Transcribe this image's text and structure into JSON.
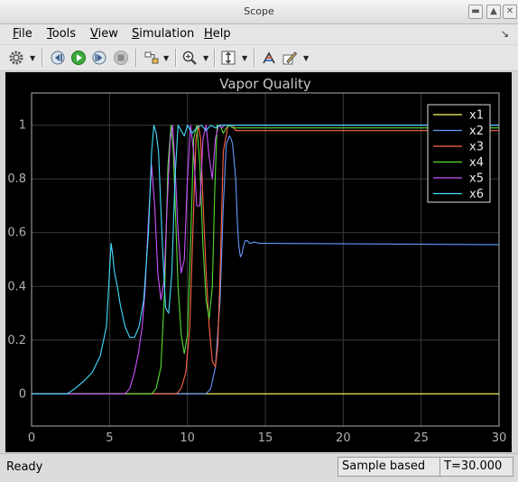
{
  "window": {
    "title": "Scope"
  },
  "menu": {
    "items": [
      {
        "accel": "F",
        "rest": "ile"
      },
      {
        "accel": "T",
        "rest": "ools"
      },
      {
        "accel": "V",
        "rest": "iew"
      },
      {
        "accel": "S",
        "rest": "imulation"
      },
      {
        "accel": "H",
        "rest": "elp"
      }
    ]
  },
  "toolbar": {
    "icons": [
      "gear-icon",
      "step-back-icon",
      "run-icon",
      "step-forward-icon",
      "stop-icon",
      "highlight-block-icon",
      "zoom-icon",
      "autoscale-icon",
      "legend-icon",
      "style-icon"
    ]
  },
  "chart_data": {
    "type": "line",
    "title": "Vapor Quality",
    "xlim": [
      0,
      30
    ],
    "ylim": [
      -0.12,
      1.12
    ],
    "xticks": [
      0,
      5,
      10,
      15,
      20,
      25,
      30
    ],
    "yticks": [
      0,
      0.2,
      0.4,
      0.6,
      0.8,
      1
    ],
    "ytick_labels": [
      "0",
      "0.2",
      "0.4",
      "0.6",
      "0.8",
      "1"
    ],
    "grid": true,
    "legend_position": "top-right",
    "colors": {
      "background": "#000000",
      "axes": "#b0b0b0",
      "title": "#c8c8c8"
    },
    "series": [
      {
        "name": "x1",
        "color": "#ffff66",
        "x": [
          0,
          30
        ],
        "y": [
          0,
          0
        ]
      },
      {
        "name": "x2",
        "color": "#6699ff",
        "x": [
          0,
          11.2,
          11.5,
          11.8,
          12.1,
          12.3,
          12.5,
          12.7,
          12.8,
          12.9,
          13.1,
          13.2,
          13.3,
          13.4,
          13.5,
          13.6,
          13.7,
          13.85,
          14.0,
          14.3,
          14.6,
          15.0,
          30
        ],
        "y": [
          0,
          0,
          0.02,
          0.1,
          0.35,
          0.7,
          0.93,
          0.96,
          0.95,
          0.93,
          0.8,
          0.65,
          0.55,
          0.51,
          0.52,
          0.55,
          0.57,
          0.57,
          0.56,
          0.565,
          0.56,
          0.56,
          0.555
        ]
      },
      {
        "name": "x3",
        "color": "#ff6644",
        "x": [
          0,
          9.3,
          9.6,
          9.9,
          10.15,
          10.35,
          10.55,
          10.7,
          10.85,
          11.0,
          11.2,
          11.4,
          11.6,
          11.8,
          11.95,
          12.1,
          12.3,
          12.6,
          12.9,
          13.1,
          30
        ],
        "y": [
          0,
          0,
          0.02,
          0.08,
          0.25,
          0.6,
          0.95,
          1.0,
          0.95,
          0.72,
          0.45,
          0.25,
          0.12,
          0.1,
          0.18,
          0.45,
          0.9,
          1.0,
          1.0,
          0.98,
          0.98
        ]
      },
      {
        "name": "x4",
        "color": "#55dd33",
        "x": [
          0,
          7.7,
          8.0,
          8.3,
          8.55,
          8.75,
          8.95,
          9.1,
          9.25,
          9.4,
          9.6,
          9.8,
          10.0,
          10.2,
          10.4,
          10.6,
          10.8,
          11.0,
          11.2,
          11.4,
          11.6,
          11.75,
          11.9,
          12.1,
          12.3,
          12.5,
          12.7,
          12.9,
          30
        ],
        "y": [
          0,
          0,
          0.02,
          0.1,
          0.4,
          0.85,
          1.0,
          0.9,
          0.65,
          0.4,
          0.22,
          0.15,
          0.22,
          0.55,
          0.95,
          1.0,
          0.85,
          0.55,
          0.35,
          0.28,
          0.4,
          0.75,
          1.0,
          1.0,
          0.97,
          0.99,
          1.0,
          0.99,
          0.99
        ]
      },
      {
        "name": "x5",
        "color": "#cc55ff",
        "x": [
          0,
          6.0,
          6.3,
          6.6,
          6.85,
          7.1,
          7.3,
          7.5,
          7.7,
          7.9,
          8.1,
          8.3,
          8.5,
          8.7,
          8.9,
          9.05,
          9.2,
          9.4,
          9.6,
          9.8,
          10.0,
          10.2,
          10.4,
          10.6,
          10.8,
          11.0,
          11.2,
          11.4,
          11.6,
          11.8,
          12.0,
          12.2,
          12.4,
          12.6,
          30
        ],
        "y": [
          0,
          0,
          0.02,
          0.08,
          0.15,
          0.25,
          0.4,
          0.65,
          0.85,
          0.7,
          0.45,
          0.35,
          0.42,
          0.7,
          0.95,
          1.0,
          0.85,
          0.6,
          0.45,
          0.5,
          0.8,
          1.0,
          0.9,
          0.7,
          0.7,
          0.95,
          1.0,
          0.88,
          0.8,
          0.95,
          1.0,
          0.99,
          1.0,
          1.0,
          1.0
        ]
      },
      {
        "name": "x6",
        "color": "#44ddff",
        "x": [
          0,
          2.3,
          2.8,
          3.4,
          3.9,
          4.4,
          4.8,
          5.0,
          5.1,
          5.2,
          5.3,
          5.5,
          5.7,
          6.0,
          6.3,
          6.6,
          6.9,
          7.2,
          7.5,
          7.7,
          7.85,
          8.0,
          8.15,
          8.4,
          8.6,
          8.8,
          9.0,
          9.2,
          9.4,
          9.6,
          9.8,
          10.0,
          10.3,
          10.6,
          10.9,
          11.2,
          11.5,
          11.8,
          12.1,
          12.4,
          30
        ],
        "y": [
          0,
          0,
          0.02,
          0.05,
          0.08,
          0.14,
          0.25,
          0.45,
          0.56,
          0.52,
          0.46,
          0.4,
          0.33,
          0.25,
          0.21,
          0.21,
          0.25,
          0.35,
          0.6,
          0.9,
          1.0,
          0.97,
          0.9,
          0.55,
          0.32,
          0.3,
          0.45,
          0.8,
          1.0,
          0.98,
          0.96,
          1.0,
          0.97,
          0.99,
          1.0,
          0.98,
          1.0,
          0.99,
          1.0,
          1.0,
          1.0
        ]
      }
    ]
  },
  "status": {
    "ready": "Ready",
    "mode": "Sample based",
    "time": "T=30.000"
  }
}
